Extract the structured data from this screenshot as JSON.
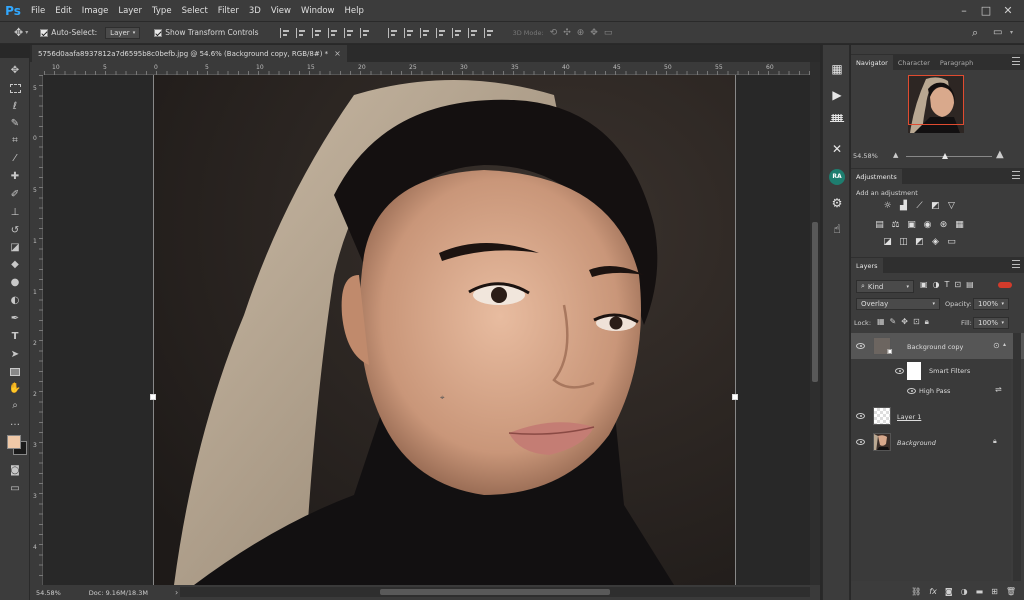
{
  "app": {
    "logo": "Ps",
    "menu": [
      "File",
      "Edit",
      "Image",
      "Layer",
      "Type",
      "Select",
      "Filter",
      "3D",
      "View",
      "Window",
      "Help"
    ],
    "window_controls": [
      "minimize-icon",
      "maximize-icon",
      "close-icon"
    ]
  },
  "options": {
    "auto_select_label": "Auto-Select:",
    "auto_select_value": "Layer",
    "transform_label": "Show Transform Controls",
    "mode_3d_label": "3D Mode:"
  },
  "document": {
    "tab_title": "5756d0aafa8937812a7d6595b8c0befb.jpg @ 54.6% (Background copy, RGB/8#) *",
    "close": "×"
  },
  "ruler": {
    "top_ticks": [
      "10",
      "5",
      "0",
      "5",
      "10",
      "15",
      "20",
      "25",
      "30",
      "35",
      "40",
      "45",
      "50",
      "55",
      "60",
      "65"
    ],
    "left_ticks": [
      "5",
      "0",
      "5",
      "1",
      "1",
      "2",
      "2",
      "3",
      "3",
      "4",
      "4"
    ]
  },
  "status": {
    "zoom": "54.58%",
    "doc": "Doc: 9.16M/18.3M"
  },
  "navigator": {
    "tabs": [
      "Navigator",
      "Character",
      "Paragraph"
    ],
    "zoom": "54.58%"
  },
  "adjustments": {
    "title": "Adjustments",
    "subtitle": "Add an adjustment"
  },
  "layers": {
    "title": "Layers",
    "kind": "Kind",
    "blend_mode": "Overlay",
    "opacity_label": "Opacity:",
    "opacity": "100%",
    "lock_label": "Lock:",
    "fill_label": "Fill:",
    "fill": "100%",
    "items": [
      {
        "name": "Background copy",
        "type": "smart"
      },
      {
        "name": "Smart Filters",
        "type": "filters"
      },
      {
        "name": "High Pass",
        "type": "filter"
      },
      {
        "name": "Layer 1",
        "type": "empty"
      },
      {
        "name": "Background",
        "type": "photo"
      }
    ]
  },
  "colors": {
    "accent": "#31a8ff",
    "foreground_swatch": "#f0c9a8",
    "background_swatch": "#1a1a1a",
    "navigator_frame": "#e04b30"
  }
}
